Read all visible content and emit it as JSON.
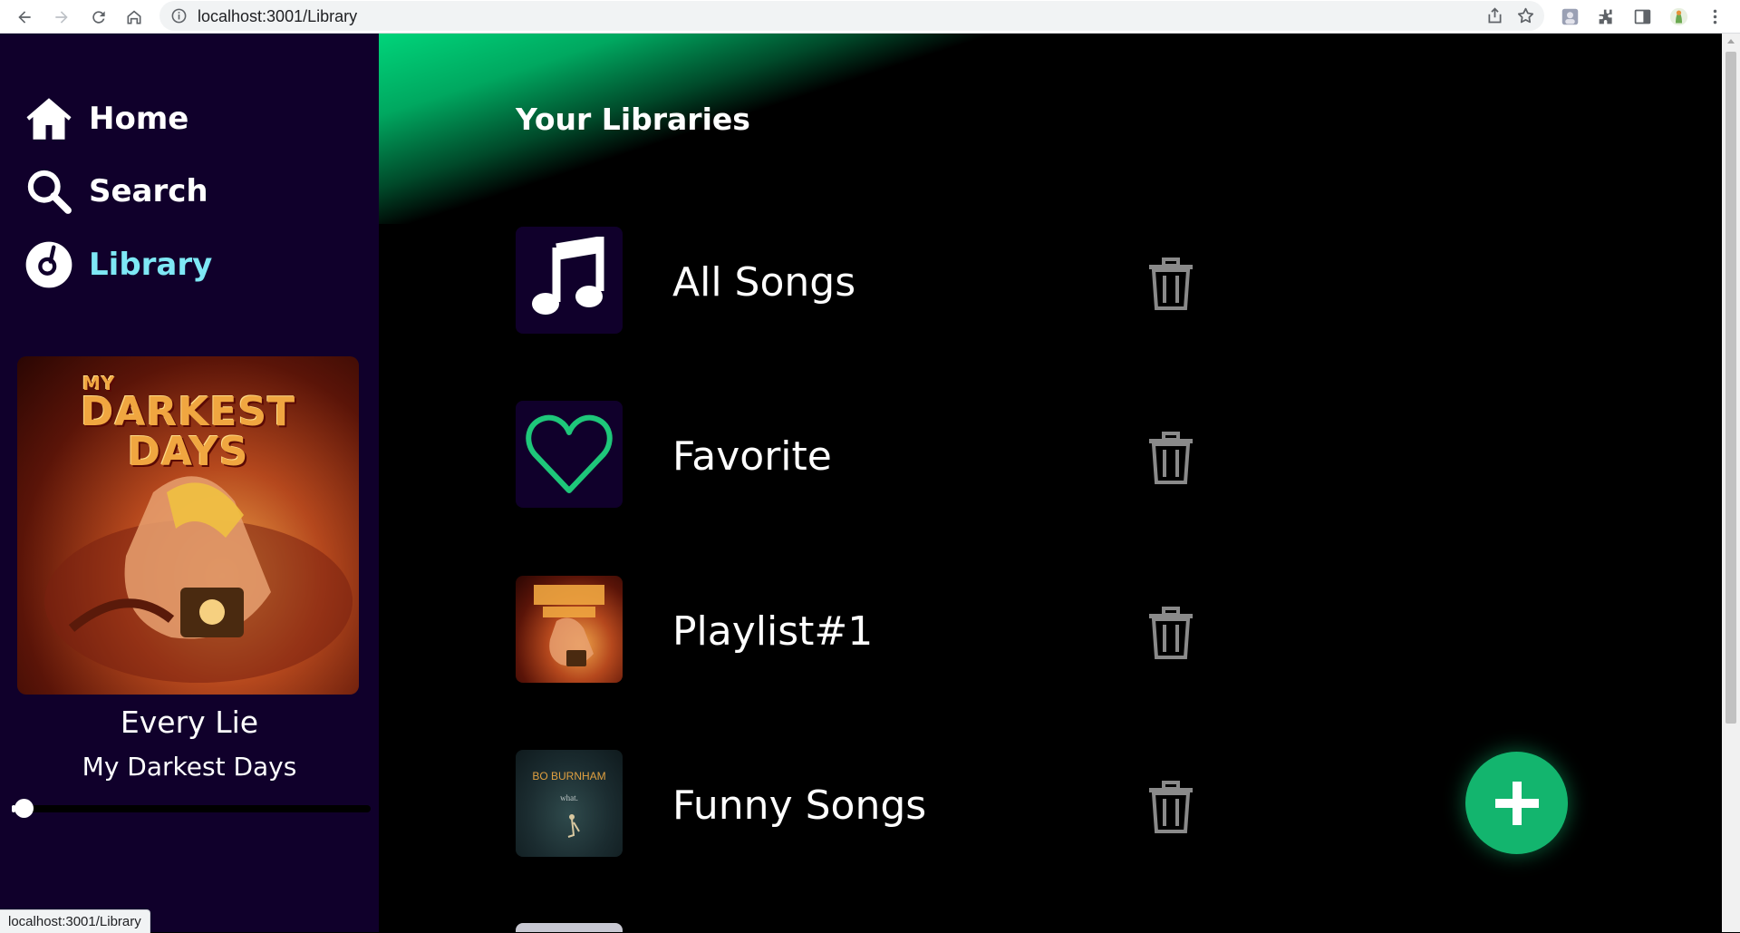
{
  "browser": {
    "url": "localhost:3001/Library",
    "status_url": "localhost:3001/Library"
  },
  "sidebar": {
    "nav": [
      {
        "label": "Home",
        "icon": "home-icon",
        "active": false
      },
      {
        "label": "Search",
        "icon": "search-icon",
        "active": false
      },
      {
        "label": "Library",
        "icon": "library-disc-icon",
        "active": true
      }
    ],
    "now_playing": {
      "album_art_text_small": "MY",
      "album_art_text_line1": "DARKEST",
      "album_art_text_line2": "DAYS",
      "title": "Every Lie",
      "artist": "My Darkest Days",
      "progress": 0.01
    }
  },
  "main": {
    "title": "Your Libraries",
    "libraries": [
      {
        "name": "All Songs",
        "thumb": "music-note-icon"
      },
      {
        "name": "Favorite",
        "thumb": "heart-icon"
      },
      {
        "name": "Playlist#1",
        "thumb": "album-cover"
      },
      {
        "name": "Funny Songs",
        "thumb": "album-cover",
        "cover_text": "BO BURNHAM",
        "cover_subtext": "what."
      }
    ],
    "add_button_icon": "plus-icon"
  },
  "colors": {
    "sidebar_bg": "#10002b",
    "accent_green": "#13b56e",
    "active_nav": "#7ee8f5",
    "heart_green": "#1ec77a"
  }
}
